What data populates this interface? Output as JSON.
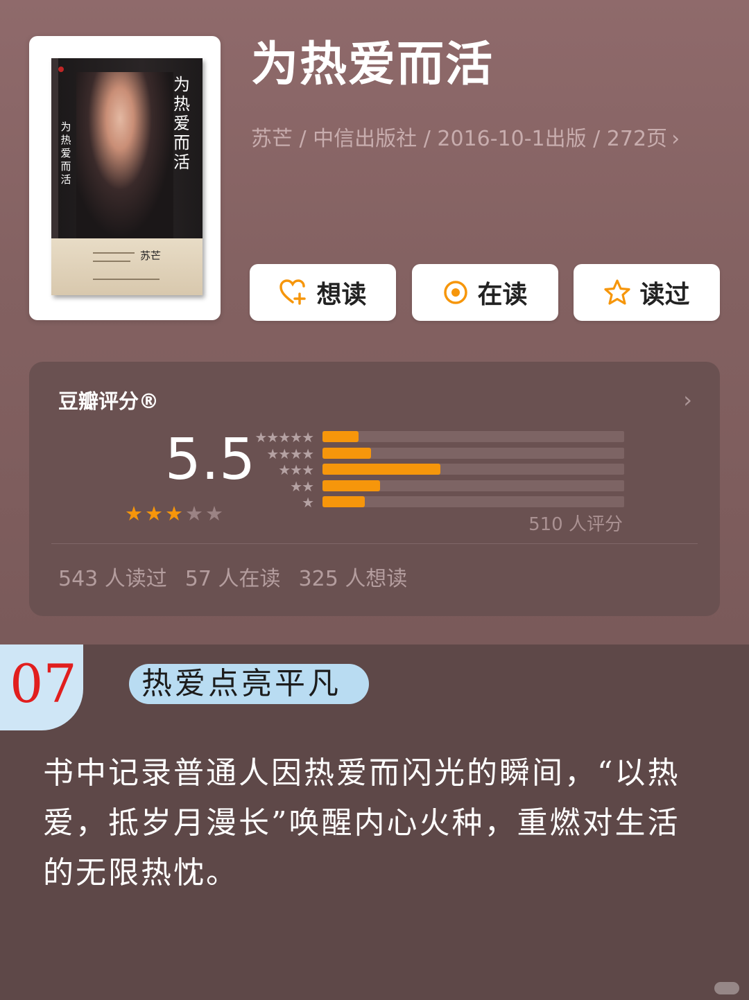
{
  "book": {
    "title": "为热爱而活",
    "meta": "苏芒 / 中信出版社 / 2016-10-1出版 / 272页",
    "chevron": "›",
    "cover": {
      "vertical_title": "为热爱而活",
      "spine_title": "为热爱而活",
      "author": "苏芒"
    }
  },
  "actions": [
    {
      "label": "想读",
      "icon": "heart-plus-icon"
    },
    {
      "label": "在读",
      "icon": "reading-circle-icon"
    },
    {
      "label": "读过",
      "icon": "star-outline-icon"
    }
  ],
  "rating": {
    "title": "豆瓣评分®",
    "chevron": "›",
    "score": "5.5",
    "stars_filled": 3,
    "stars_total": 5,
    "distribution_labels": [
      "★★★★★",
      "★★★★",
      "★★★",
      "★★",
      "★"
    ],
    "distribution": [
      0.12,
      0.16,
      0.39,
      0.19,
      0.14
    ],
    "rating_count": "510 人评分",
    "read_stats": [
      "543 人读过",
      "57 人在读",
      "325 人想读"
    ],
    "colors": {
      "accent": "#f6960b",
      "star_filled": "#f6960b",
      "star_empty": "#9b8384"
    }
  },
  "section": {
    "number": "07",
    "heading": "热爱点亮平凡",
    "body": "书中记录普通人因热爱而闪光的瞬间，“以热爱，抵岁月漫长”唤醒内心火种，重燃对生活的无限热忱。"
  }
}
